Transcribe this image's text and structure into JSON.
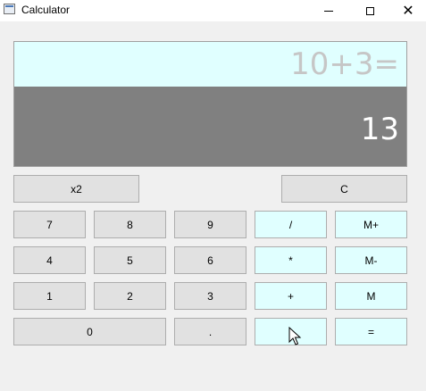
{
  "window": {
    "title": "Calculator",
    "controls": {
      "minimize": "minimize",
      "maximize": "maximize",
      "close": "close"
    }
  },
  "display": {
    "expression": "10+3=",
    "result": "13"
  },
  "buttons": {
    "square": "x2",
    "clear": "C",
    "d7": "7",
    "d8": "8",
    "d9": "9",
    "divide": "/",
    "mplus": "M+",
    "d4": "4",
    "d5": "5",
    "d6": "6",
    "multiply": "*",
    "mminus": "M-",
    "d1": "1",
    "d2": "2",
    "d3": "3",
    "plus": "+",
    "mem": "M",
    "d0": "0",
    "dot": ".",
    "minus": "",
    "equals": "="
  },
  "colors": {
    "expression_bg": "#e0ffff",
    "result_bg": "#808080",
    "operator_bg": "#e0ffff",
    "digit_bg": "#e1e1e1"
  }
}
